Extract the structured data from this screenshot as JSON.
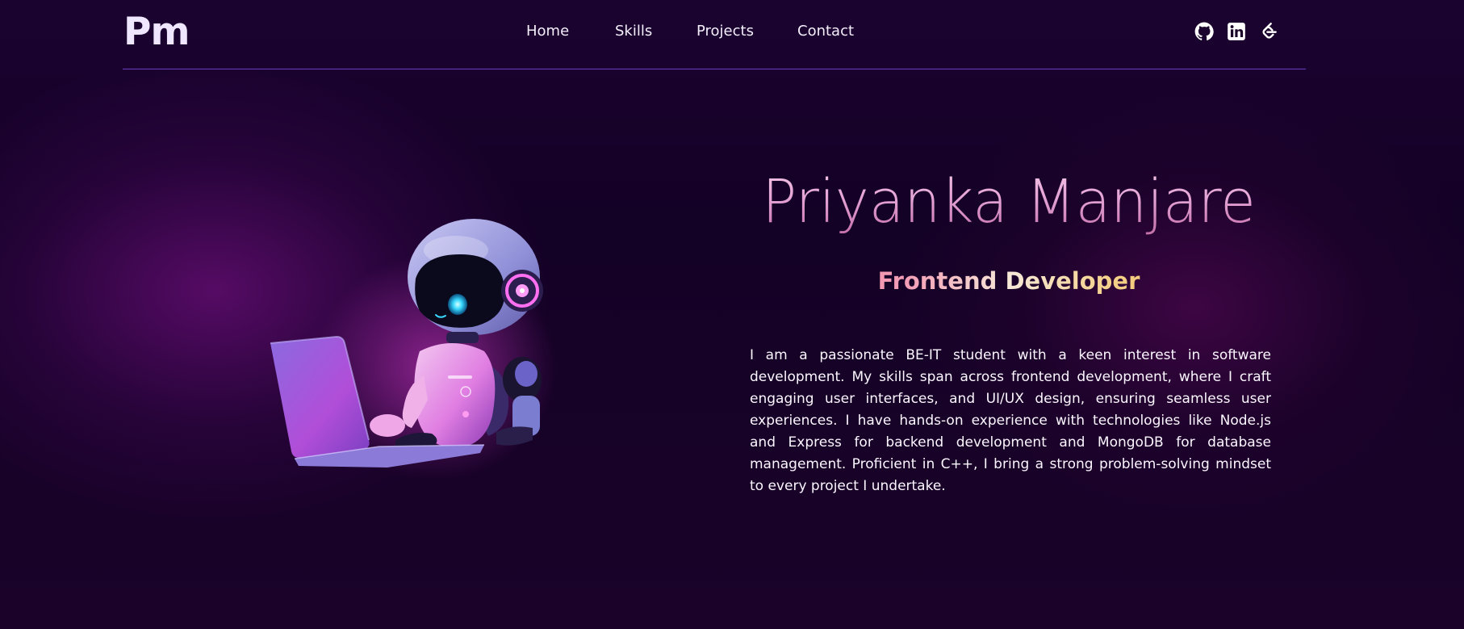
{
  "header": {
    "logo": "Pm",
    "nav": [
      {
        "label": "Home"
      },
      {
        "label": "Skills"
      },
      {
        "label": "Projects"
      },
      {
        "label": "Contact"
      }
    ],
    "social": [
      {
        "icon": "github-icon"
      },
      {
        "icon": "linkedin-icon"
      },
      {
        "icon": "leetcode-icon"
      }
    ]
  },
  "hero": {
    "name": "Priyanka Manjare",
    "role": "Frontend Developer",
    "bio": "I am a passionate BE-IT student with a keen interest in software development. My skills span across frontend development, where I craft engaging user interfaces, and UI/UX design, ensuring seamless user experiences. I have hands-on experience with technologies like Node.js and Express for backend development and MongoDB for database management. Proficient in C++, I bring a strong problem-solving mindset to every project I undertake.",
    "illustration": "robot-with-laptop"
  },
  "colors": {
    "background": "#16011f",
    "nav_border": "#6a3bc4",
    "name_gradient": [
      "#f4c4e6",
      "#c46fa9"
    ],
    "role_gradient": [
      "#f47ba6",
      "#f7e9d8",
      "#f1b447"
    ],
    "accent_magenta": "#e23dd6"
  }
}
